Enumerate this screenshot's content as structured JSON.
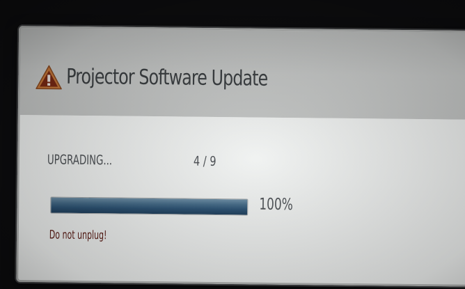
{
  "dialog": {
    "title": "Projector Software Update",
    "icon": "warning-icon",
    "status_label": "UPGRADING...",
    "step_counter": "4 / 9",
    "progress": {
      "value": 1.0,
      "percent_label": "100%"
    },
    "warning_text": "Do not unplug!"
  },
  "colors": {
    "title_bar": "#c5c7c6",
    "body": "#eff1f0",
    "progress_fill": "#2c5273",
    "warning_text": "#5b1b14",
    "warning_icon_outline": "#c87a3a",
    "warning_icon_fill": "#7a2a14"
  }
}
